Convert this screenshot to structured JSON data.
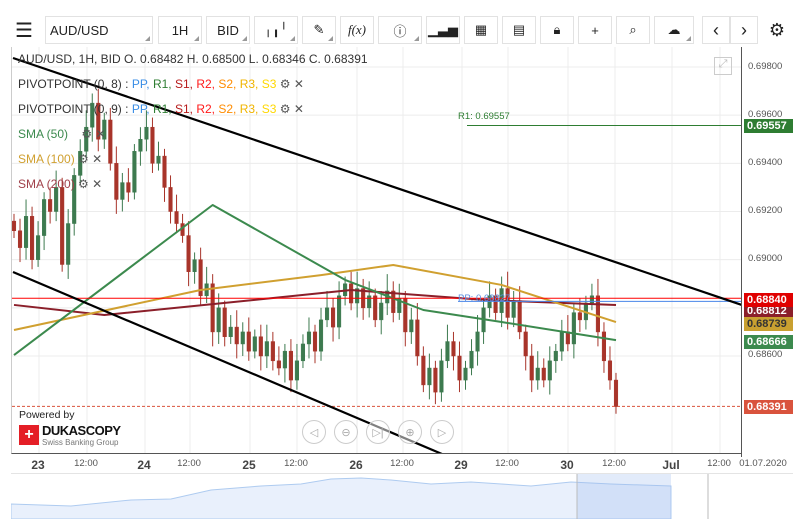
{
  "toolbar": {
    "symbol": "AUD/USD",
    "period": "1H",
    "side": "BID",
    "fx_label": "f(x)"
  },
  "legend": {
    "ohlc": "AUD/USD, 1H, BID   O. 0.68482 H. 0.68500 L. 0.68346 C. 0.68391",
    "pivot1": "PIVOTPOINT (0, 8)",
    "pivot2": "PIVOTPOINT (0, 9)",
    "pivot_items": [
      {
        "t": "PP",
        "c": "#3a8ee6"
      },
      {
        "t": "R1",
        "c": "#2e7d32"
      },
      {
        "t": "S1",
        "c": "#b71c1c"
      },
      {
        "t": "R2",
        "c": "#ff1a1a"
      },
      {
        "t": "S2",
        "c": "#ff8c00"
      },
      {
        "t": "R3",
        "c": "#f0b400"
      },
      {
        "t": "S3",
        "c": "#ffd800"
      }
    ],
    "sma50": "SMA (50)",
    "sma100": "SMA (100)",
    "sma200": "SMA (200)"
  },
  "annotations": {
    "r1": "R1: 0.69557",
    "pp": "PP: 0.68827"
  },
  "price_axis": {
    "ticks": [
      "0.69800",
      "0.69600",
      "0.69400",
      "0.69200",
      "0.69000",
      "0.68600"
    ],
    "badges": {
      "r1": "0.69557",
      "red": "0.68840",
      "sma200": "0.68812",
      "sma100": "0.68739",
      "sma50": "0.68666",
      "last": "0.68391"
    }
  },
  "x_axis": [
    "23",
    "12:00",
    "24",
    "12:00",
    "25",
    "12:00",
    "26",
    "12:00",
    "29",
    "12:00",
    "30",
    "12:00",
    "Jul",
    "12:00",
    "01.07.2020"
  ],
  "branding": {
    "powered": "Powered by",
    "name": "DUKASCOPY",
    "sub": "Swiss Banking Group"
  },
  "colors": {
    "up": "#3d7a4f",
    "down": "#a8342a",
    "sma50": "#3c8a4e",
    "sma100": "#d0a030",
    "sma200": "#8b1f2a"
  },
  "chart_data": {
    "type": "candlestick",
    "ylim": [
      0.684,
      0.698
    ],
    "closes": [
      0.6912,
      0.6905,
      0.6918,
      0.69,
      0.691,
      0.6925,
      0.692,
      0.693,
      0.6898,
      0.6915,
      0.6935,
      0.6945,
      0.6955,
      0.6965,
      0.695,
      0.6958,
      0.694,
      0.6925,
      0.6932,
      0.6928,
      0.6945,
      0.695,
      0.6955,
      0.694,
      0.6943,
      0.693,
      0.692,
      0.6915,
      0.691,
      0.6895,
      0.69,
      0.6885,
      0.689,
      0.687,
      0.688,
      0.6868,
      0.6872,
      0.6865,
      0.687,
      0.6862,
      0.6868,
      0.686,
      0.6866,
      0.6858,
      0.6855,
      0.6862,
      0.685,
      0.6858,
      0.6865,
      0.687,
      0.6862,
      0.6875,
      0.688,
      0.6872,
      0.6885,
      0.689,
      0.6882,
      0.6888,
      0.688,
      0.6885,
      0.6875,
      0.6882,
      0.6887,
      0.6878,
      0.6884,
      0.687,
      0.6875,
      0.686,
      0.6848,
      0.6855,
      0.6845,
      0.6858,
      0.6866,
      0.686,
      0.685,
      0.6855,
      0.6862,
      0.687,
      0.688,
      0.6885,
      0.6878,
      0.6888,
      0.6876,
      0.6883,
      0.687,
      0.686,
      0.685,
      0.6855,
      0.685,
      0.6858,
      0.6862,
      0.687,
      0.6865,
      0.6878,
      0.6875,
      0.6882,
      0.6885,
      0.687,
      0.6858,
      0.685,
      0.6839
    ],
    "sma50": [
      [
        0,
        0.68604
      ],
      [
        33,
        0.69227
      ],
      [
        55,
        0.68916
      ],
      [
        68,
        0.68791
      ],
      [
        81,
        0.68741
      ],
      [
        100,
        0.68666
      ]
    ],
    "sma100": [
      [
        0,
        0.68708
      ],
      [
        31,
        0.68874
      ],
      [
        51,
        0.68936
      ],
      [
        63,
        0.68978
      ],
      [
        81,
        0.68895
      ],
      [
        100,
        0.68741
      ]
    ],
    "sma200": [
      [
        0,
        0.68812
      ],
      [
        15,
        0.6877
      ],
      [
        40,
        0.68833
      ],
      [
        56,
        0.68874
      ],
      [
        78,
        0.68833
      ],
      [
        100,
        0.68812
      ]
    ],
    "pivot_r1": 0.69557,
    "pivot_pp": 0.68827,
    "red_line": 0.6884,
    "last": 0.68391
  }
}
